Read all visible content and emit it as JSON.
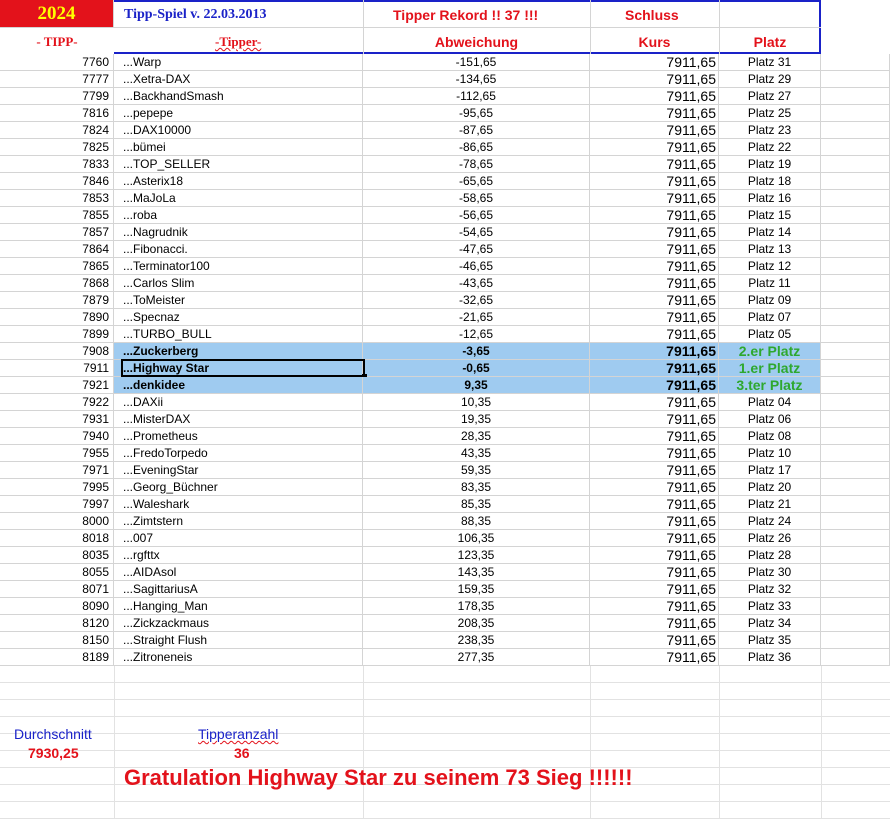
{
  "header": {
    "year": "2024",
    "title": "Tipp-Spiel v. 22.03.2013",
    "record": "Tipper Rekord !!  37  !!!",
    "schluss": "Schluss",
    "col_tipp": "- TIPP-",
    "col_tipper": "-Tipper-",
    "col_abweichung": "Abweichung",
    "col_kurs": "Kurs",
    "col_platz": "Platz"
  },
  "colors": {
    "red": "#e3121b",
    "blue": "#1a22c8",
    "highlight": "#9fcbf0",
    "green": "#2ea82e"
  },
  "rows": [
    {
      "tipp": "7760",
      "name": "...Warp",
      "abw": "-151,65",
      "kurs": "7911,65",
      "platz": "Platz 31"
    },
    {
      "tipp": "7777",
      "name": "...Xetra-DAX",
      "abw": "-134,65",
      "kurs": "7911,65",
      "platz": "Platz 29"
    },
    {
      "tipp": "7799",
      "name": "...BackhandSmash",
      "abw": "-112,65",
      "kurs": "7911,65",
      "platz": "Platz 27"
    },
    {
      "tipp": "7816",
      "name": "...pepepe",
      "abw": "-95,65",
      "kurs": "7911,65",
      "platz": "Platz 25"
    },
    {
      "tipp": "7824",
      "name": "...DAX10000",
      "abw": "-87,65",
      "kurs": "7911,65",
      "platz": "Platz 23"
    },
    {
      "tipp": "7825",
      "name": "...bümei",
      "abw": "-86,65",
      "kurs": "7911,65",
      "platz": "Platz 22"
    },
    {
      "tipp": "7833",
      "name": "...TOP_SELLER",
      "abw": "-78,65",
      "kurs": "7911,65",
      "platz": "Platz 19"
    },
    {
      "tipp": "7846",
      "name": "...Asterix18",
      "abw": "-65,65",
      "kurs": "7911,65",
      "platz": "Platz 18"
    },
    {
      "tipp": "7853",
      "name": "...MaJoLa",
      "abw": "-58,65",
      "kurs": "7911,65",
      "platz": "Platz 16"
    },
    {
      "tipp": "7855",
      "name": "...roba",
      "abw": "-56,65",
      "kurs": "7911,65",
      "platz": "Platz 15"
    },
    {
      "tipp": "7857",
      "name": "...Nagrudnik",
      "abw": "-54,65",
      "kurs": "7911,65",
      "platz": "Platz 14"
    },
    {
      "tipp": "7864",
      "name": "...Fibonacci.",
      "abw": "-47,65",
      "kurs": "7911,65",
      "platz": "Platz 13"
    },
    {
      "tipp": "7865",
      "name": "...Terminator100",
      "abw": "-46,65",
      "kurs": "7911,65",
      "platz": "Platz 12"
    },
    {
      "tipp": "7868",
      "name": "...Carlos Slim",
      "abw": "-43,65",
      "kurs": "7911,65",
      "platz": "Platz 11"
    },
    {
      "tipp": "7879",
      "name": "...ToMeister",
      "abw": "-32,65",
      "kurs": "7911,65",
      "platz": "Platz 09"
    },
    {
      "tipp": "7890",
      "name": "...Specnaz",
      "abw": "-21,65",
      "kurs": "7911,65",
      "platz": "Platz 07"
    },
    {
      "tipp": "7899",
      "name": "...TURBO_BULL",
      "abw": "-12,65",
      "kurs": "7911,65",
      "platz": "Platz 05"
    },
    {
      "tipp": "7908",
      "name": "...Zuckerberg",
      "abw": "-3,65",
      "kurs": "7911,65",
      "platz": "2.er Platz",
      "hl": true
    },
    {
      "tipp": "7911",
      "name": "...Highway Star",
      "abw": "-0,65",
      "kurs": "7911,65",
      "platz": "1.er Platz",
      "hl": true,
      "sel": true
    },
    {
      "tipp": "7921",
      "name": "...denkidee",
      "abw": "9,35",
      "kurs": "7911,65",
      "platz": "3.ter Platz",
      "hl": true
    },
    {
      "tipp": "7922",
      "name": "...DAXii",
      "abw": "10,35",
      "kurs": "7911,65",
      "platz": "Platz 04"
    },
    {
      "tipp": "7931",
      "name": "...MisterDAX",
      "abw": "19,35",
      "kurs": "7911,65",
      "platz": "Platz 06"
    },
    {
      "tipp": "7940",
      "name": "...Prometheus",
      "abw": "28,35",
      "kurs": "7911,65",
      "platz": "Platz 08"
    },
    {
      "tipp": "7955",
      "name": "...FredoTorpedo",
      "abw": "43,35",
      "kurs": "7911,65",
      "platz": "Platz 10"
    },
    {
      "tipp": "7971",
      "name": "...EveningStar",
      "abw": "59,35",
      "kurs": "7911,65",
      "platz": "Platz 17"
    },
    {
      "tipp": "7995",
      "name": "...Georg_Büchner",
      "abw": "83,35",
      "kurs": "7911,65",
      "platz": "Platz 20"
    },
    {
      "tipp": "7997",
      "name": "...Waleshark",
      "abw": "85,35",
      "kurs": "7911,65",
      "platz": "Platz 21"
    },
    {
      "tipp": "8000",
      "name": "...Zimtstern",
      "abw": "88,35",
      "kurs": "7911,65",
      "platz": "Platz 24"
    },
    {
      "tipp": "8018",
      "name": "...007",
      "abw": "106,35",
      "kurs": "7911,65",
      "platz": "Platz 26"
    },
    {
      "tipp": "8035",
      "name": "...rgfttx",
      "abw": "123,35",
      "kurs": "7911,65",
      "platz": "Platz 28"
    },
    {
      "tipp": "8055",
      "name": "...AIDAsol",
      "abw": "143,35",
      "kurs": "7911,65",
      "platz": "Platz 30"
    },
    {
      "tipp": "8071",
      "name": "...SagittariusA",
      "abw": "159,35",
      "kurs": "7911,65",
      "platz": "Platz 32"
    },
    {
      "tipp": "8090",
      "name": "...Hanging_Man",
      "abw": "178,35",
      "kurs": "7911,65",
      "platz": "Platz 33"
    },
    {
      "tipp": "8120",
      "name": "...Zickzackmaus",
      "abw": "208,35",
      "kurs": "7911,65",
      "platz": "Platz 34"
    },
    {
      "tipp": "8150",
      "name": "...Straight Flush",
      "abw": "238,35",
      "kurs": "7911,65",
      "platz": "Platz 35"
    },
    {
      "tipp": "8189",
      "name": "...Zitroneneis",
      "abw": "277,35",
      "kurs": "7911,65",
      "platz": "Platz 36"
    }
  ],
  "footer": {
    "durchschnitt_label": "Durchschnitt",
    "durchschnitt_value": "7930,25",
    "tipperanzahl_label": "Tipperanzahl",
    "tipperanzahl_value": "36",
    "gratulation": "Gratulation Highway Star  zu seinem 73 Sieg !!!!!!"
  }
}
